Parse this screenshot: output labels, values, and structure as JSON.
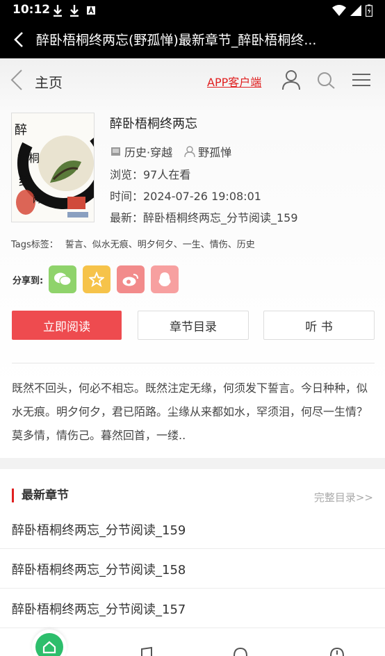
{
  "status": {
    "time": "10:12"
  },
  "appbar": {
    "title": "醉卧梧桐终两忘(野孤惮)最新章节_醉卧梧桐终..."
  },
  "header": {
    "home_label": "主页",
    "app_link": "APP客户端"
  },
  "book": {
    "title": "醉卧梧桐终两忘",
    "category": "历史·穿越",
    "author": "野孤惮",
    "views": "浏览：97人在看",
    "time": "时间：2024-07-26 19:08:01",
    "latest": "最新：醉卧梧桐终两忘_分节阅读_159",
    "cover_text": "醉卧梧桐终两忘",
    "tags_label": "Tags标签：",
    "tags": "誓言、似水无痕、明夕何夕、一生、情伤、历史"
  },
  "share": {
    "label": "分享到:",
    "colors": {
      "wechat": "#8fd36b",
      "favorite": "#f6c34a",
      "weibo": "#f28b8b",
      "qq": "#f7a0a0"
    }
  },
  "buttons": {
    "read": "立即阅读",
    "toc": "章节目录",
    "listen": "听 书"
  },
  "intro": "既然不回头，何必不相忘。既然注定无缘，何须发下誓言。今日种种，似水无痕。明夕何夕，君已陌路。尘缘从来都如水，罕须泪，何尽一生情？莫多情，情伤己。暮然回首，一缕..",
  "chapters": {
    "heading": "最新章节",
    "more": "完整目录>>",
    "items": [
      "醉卧梧桐终两忘_分节阅读_159",
      "醉卧梧桐终两忘_分节阅读_158",
      "醉卧梧桐终两忘_分节阅读_157"
    ]
  },
  "colors": {
    "accent": "#ee4b4f",
    "nav_active": "#2dbe6c"
  }
}
